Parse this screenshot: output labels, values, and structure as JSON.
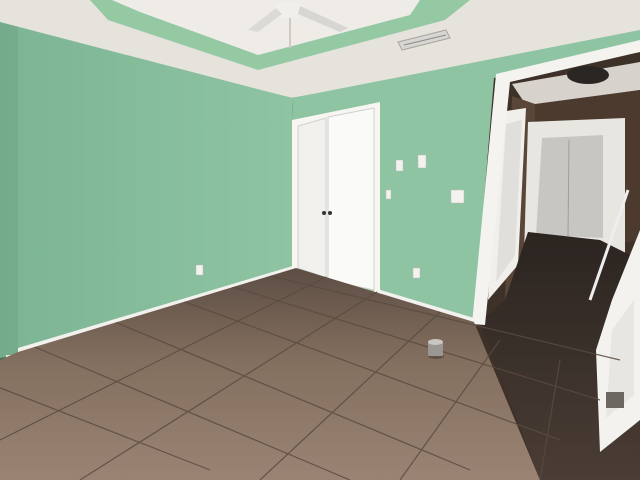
{
  "scene": {
    "kind": "photo",
    "subject": "empty-bedroom",
    "palette": {
      "wall": "#8fc4a2",
      "wall_shadow": "#7fb395",
      "ceiling": "#ece9e4",
      "tray_band": "#94c9a4",
      "floor_tile": "#8a7366",
      "floor_dark": "#3a302b",
      "trim": "#f2f1ee",
      "door": "#f4f3f0",
      "hallway": "#4a3a30",
      "hall_floor": "#2a2522"
    }
  }
}
